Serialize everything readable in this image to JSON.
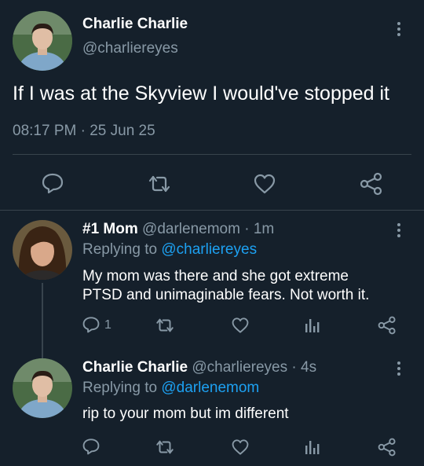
{
  "main_tweet": {
    "display_name": "Charlie Charlie",
    "handle": "@charliereyes",
    "text": "If I was at the Skyview I would've stopped it",
    "time": "08:17 PM",
    "separator": "·",
    "date": "25 Jun 25",
    "actions": {
      "reply_icon": "reply-icon",
      "retweet_icon": "retweet-icon",
      "like_icon": "heart-icon",
      "share_icon": "share-icon"
    }
  },
  "replies": [
    {
      "display_name": "#1 Mom",
      "handle": "@darlenemom",
      "separator": "·",
      "age": "1m",
      "replying_prefix": "Replying to",
      "replying_to": "@charliereyes",
      "text_line1": "My mom was there and she got extreme",
      "text_line2": "PTSD and unimaginable fears. Not worth it.",
      "reply_count": "1"
    },
    {
      "display_name": "Charlie Charlie",
      "handle": "@charliereyes",
      "separator": "·",
      "age": "4s",
      "replying_prefix": "Replying to",
      "replying_to": "@darlenemom",
      "text": "rip to your mom but im different",
      "reply_count": ""
    }
  ],
  "colors": {
    "background": "#15202b",
    "muted": "#8899a6",
    "link": "#1da1f2",
    "divider": "#38444d"
  }
}
